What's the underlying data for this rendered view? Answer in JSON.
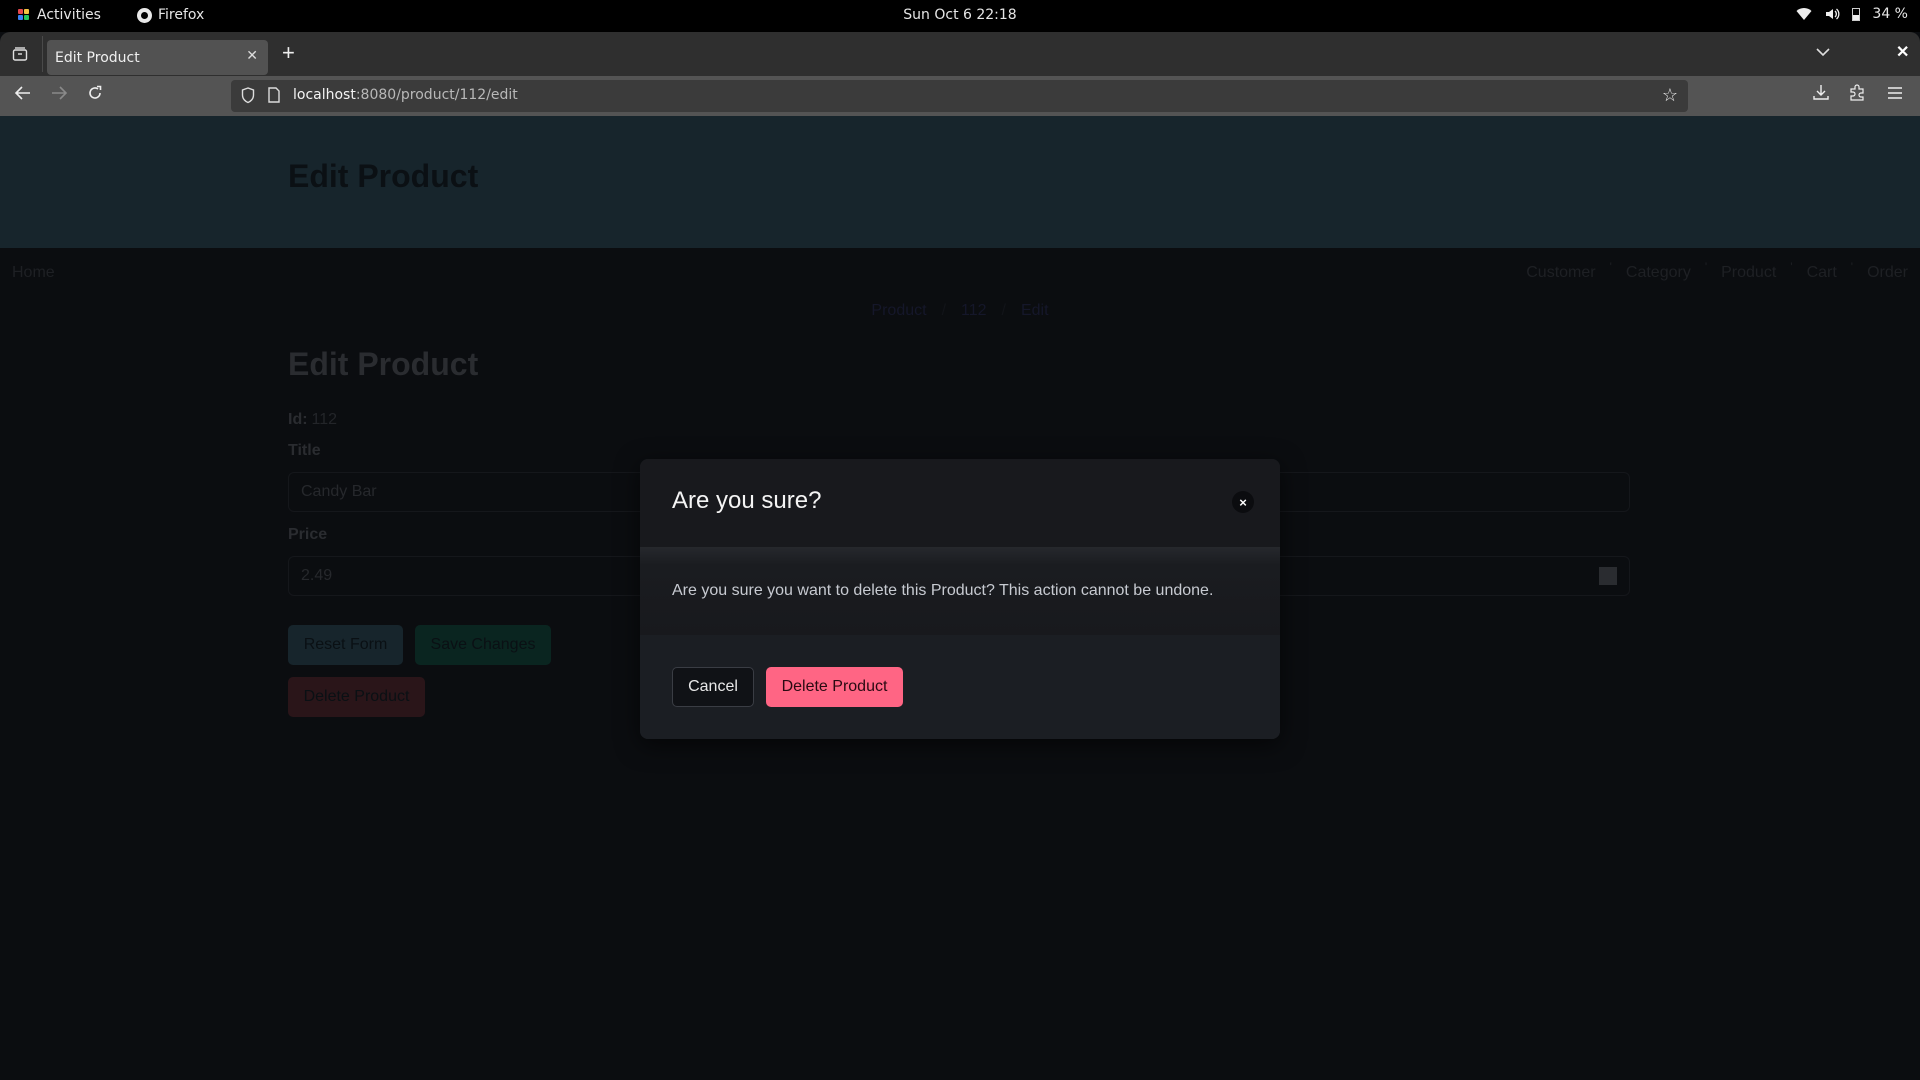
{
  "system": {
    "activities_label": "Activities",
    "app_name": "Firefox",
    "clock": "Sun Oct 6  22:18",
    "battery": "34 %"
  },
  "browser": {
    "tab_title": "Edit Product",
    "url_host": "localhost",
    "url_rest": ":8080/product/112/edit"
  },
  "page": {
    "hero_title": "Edit Product",
    "nav": {
      "home": "Home",
      "items": [
        "Customer",
        "Category",
        "Product",
        "Cart",
        "Order"
      ]
    },
    "breadcrumb": [
      "Product",
      "112",
      "Edit"
    ],
    "form": {
      "title": "Edit Product",
      "id_label": "Id:",
      "id_value": "112",
      "title_label": "Title",
      "title_value": "Candy Bar",
      "price_label": "Price",
      "price_value": "2.49",
      "reset_label": "Reset Form",
      "save_label": "Save Changes",
      "delete_label": "Delete Product"
    }
  },
  "modal": {
    "title": "Are you sure?",
    "message": "Are you sure you want to delete this Product? This action cannot be undone.",
    "cancel_label": "Cancel",
    "confirm_label": "Delete Product",
    "close_icon": "×"
  },
  "colors": {
    "danger": "#ff6584",
    "hero_bg": "#17252c",
    "page_bg": "#0b0d10",
    "modal_bg": "#1b1e23"
  }
}
